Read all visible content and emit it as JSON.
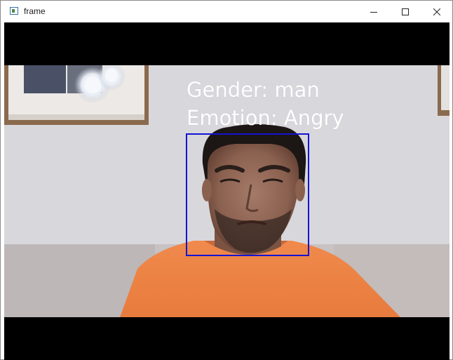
{
  "window": {
    "title": "frame"
  },
  "titlebar_buttons": {
    "minimize_icon": "minimize-icon",
    "maximize_icon": "maximize-icon",
    "close_icon": "close-icon"
  },
  "frame": {
    "gender_text": "Gender: man",
    "emotion_text": "Emotion: Angry",
    "face_box_color": "#1414d2",
    "overlay_text_color": "#ffffff"
  }
}
